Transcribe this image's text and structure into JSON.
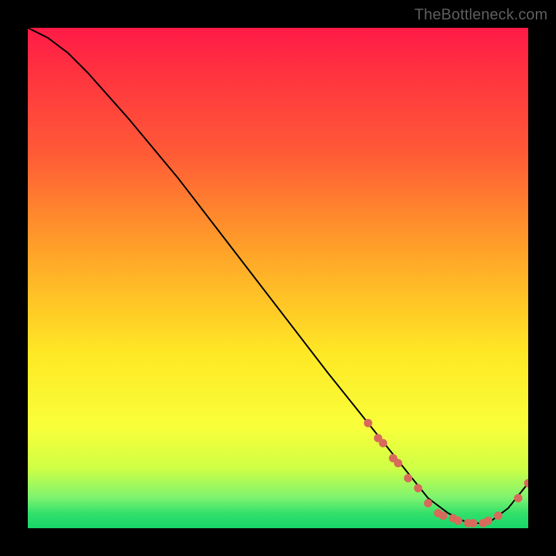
{
  "watermark": "TheBottleneck.com",
  "chart_data": {
    "type": "line",
    "title": "",
    "xlabel": "",
    "ylabel": "",
    "xlim": [
      0,
      100
    ],
    "ylim": [
      0,
      100
    ],
    "grid": false,
    "legend": false,
    "series": [
      {
        "name": "curve",
        "color": "#000000",
        "x": [
          0,
          4,
          8,
          12,
          20,
          30,
          40,
          50,
          60,
          68,
          72,
          76,
          80,
          84,
          88,
          92,
          96,
          100
        ],
        "y": [
          100,
          98,
          95,
          91,
          82,
          70,
          57,
          44,
          31,
          21,
          16,
          11,
          6,
          3,
          1,
          1,
          4,
          9
        ]
      }
    ],
    "markers": [
      {
        "name": "cluster",
        "color": "#d86a5c",
        "radius": 6,
        "points": [
          {
            "x": 68,
            "y": 21
          },
          {
            "x": 70,
            "y": 18
          },
          {
            "x": 71,
            "y": 17
          },
          {
            "x": 73,
            "y": 14
          },
          {
            "x": 74,
            "y": 13
          },
          {
            "x": 76,
            "y": 10
          },
          {
            "x": 78,
            "y": 8
          },
          {
            "x": 80,
            "y": 5
          },
          {
            "x": 82,
            "y": 3
          },
          {
            "x": 83,
            "y": 2.5
          },
          {
            "x": 85,
            "y": 2
          },
          {
            "x": 86,
            "y": 1.5
          },
          {
            "x": 88,
            "y": 1
          },
          {
            "x": 89,
            "y": 1
          },
          {
            "x": 91,
            "y": 1
          },
          {
            "x": 92,
            "y": 1.5
          },
          {
            "x": 94,
            "y": 2.5
          },
          {
            "x": 98,
            "y": 6
          },
          {
            "x": 100,
            "y": 9
          }
        ]
      }
    ]
  }
}
